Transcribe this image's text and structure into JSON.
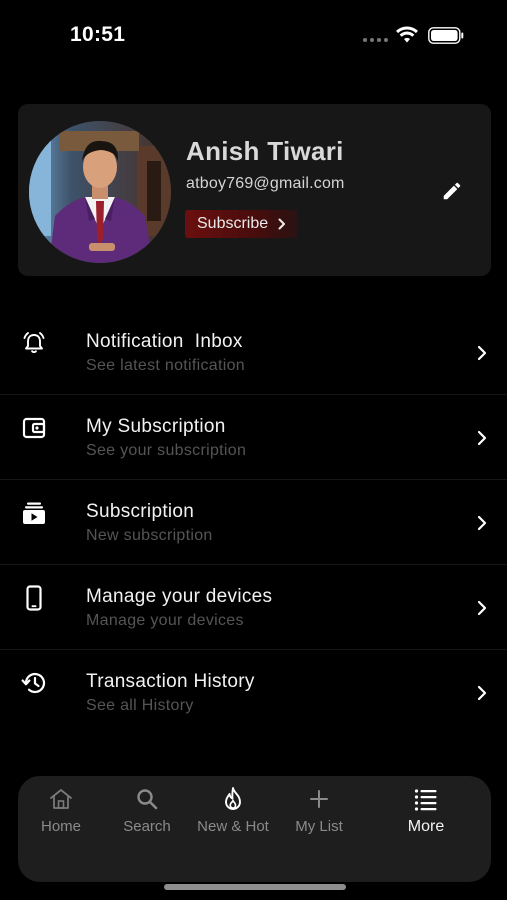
{
  "status_bar": {
    "time": "10:51"
  },
  "profile": {
    "name": "Anish Tiwari",
    "email": "atboy769@gmail.com",
    "subscribe_label": "Subscribe",
    "avatar_icon": "user-photo"
  },
  "menu": {
    "items": [
      {
        "title": "Notification  Inbox",
        "subtitle": "See latest notification",
        "icon": "bell-alarm-icon"
      },
      {
        "title": "My Subscription",
        "subtitle": "See your subscription",
        "icon": "wallet-icon"
      },
      {
        "title": "Subscription",
        "subtitle": "New subscription",
        "icon": "subscriptions-icon"
      },
      {
        "title": "Manage your devices",
        "subtitle": "Manage your devices",
        "icon": "phone-icon"
      },
      {
        "title": "Transaction History",
        "subtitle": "See all History",
        "icon": "history-icon"
      }
    ]
  },
  "tab_bar": {
    "tabs": [
      {
        "label": "Home",
        "icon": "home-icon"
      },
      {
        "label": "Search",
        "icon": "search-icon"
      },
      {
        "label": "New & Hot",
        "icon": "flame-icon"
      },
      {
        "label": "My List",
        "icon": "plus-icon"
      },
      {
        "label": "More",
        "icon": "menu-list-icon"
      }
    ],
    "active": "More"
  },
  "colors": {
    "background": "#000000",
    "card": "#171717",
    "subscribe_accent": "#6b0f0f",
    "tab_bar": "#1e1e1e"
  }
}
